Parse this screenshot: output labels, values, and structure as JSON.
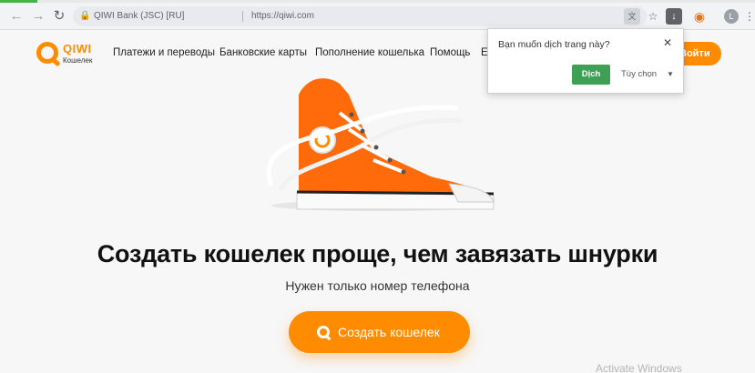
{
  "browser": {
    "page_load_progress": 0.05,
    "site_identity": "QIWI Bank (JSC) [RU]",
    "url": "https://qiwi.com",
    "profile_initial": "L",
    "icons": {
      "back": "arrow-left-icon",
      "forward": "arrow-right-icon",
      "reload": "reload-icon",
      "lock": "lock-icon",
      "translate": "translate-icon",
      "bookmark": "star-icon",
      "download": "download-icon",
      "extension": "chrome-extension-icon",
      "menu": "kebab-menu-icon"
    }
  },
  "site": {
    "logo_brand": "QIWI",
    "logo_sub": "Кошелек",
    "nav": [
      "Платежи и переводы",
      "Банковские карты",
      "Пополнение кошелька",
      "Помощь",
      "En"
    ],
    "login_label": "Войти",
    "headline": "Создать кошелек проще, чем завязать шнурки",
    "subheadline": "Нужен только номер телефона",
    "cta_label": "Создать кошелек",
    "accent_color": "#ff8c00"
  },
  "translate_popup": {
    "question": "Bạn muốn dịch trang này?",
    "translate_label": "Dịch",
    "options_label": "Tùy chọn",
    "button_color": "#3ea055"
  },
  "os": {
    "watermark": "Activate Windows"
  }
}
